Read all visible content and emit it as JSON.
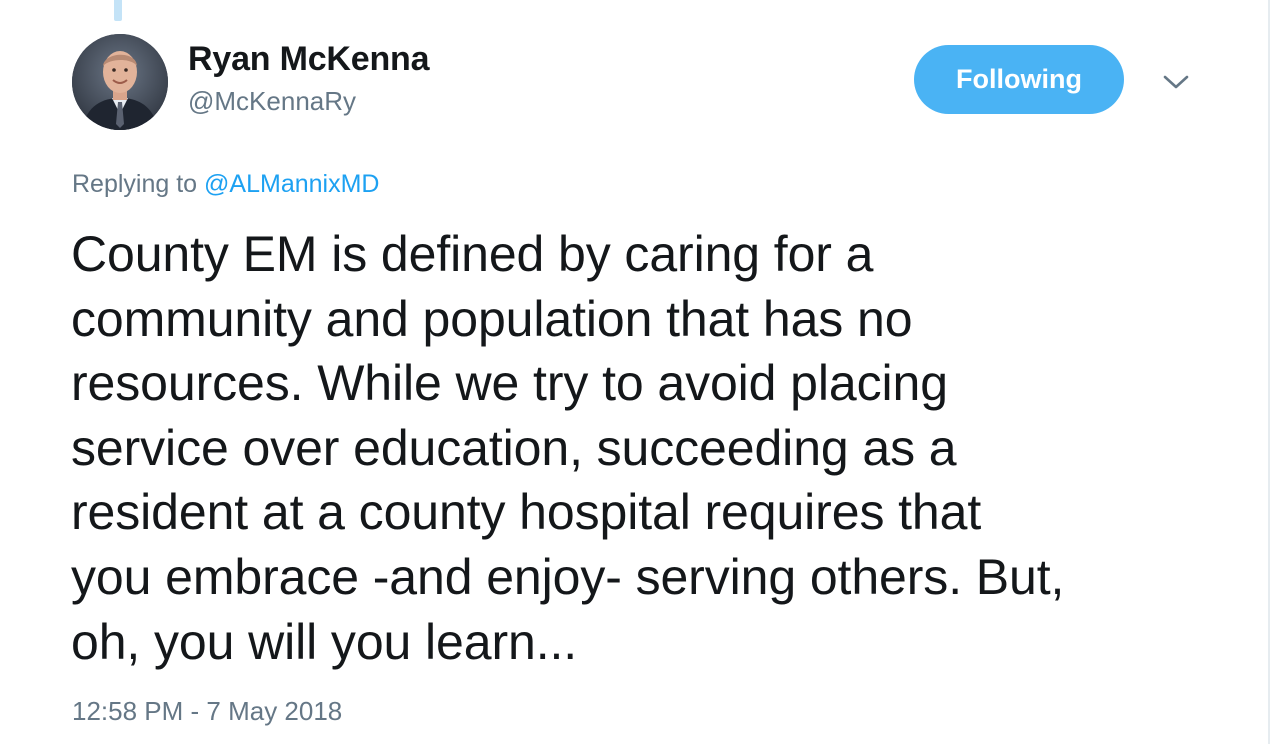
{
  "author": {
    "display_name": "Ryan McKenna",
    "screen_name": "@McKennaRy",
    "avatar_icon": "profile-photo"
  },
  "follow_button": {
    "label": "Following",
    "color": "#4ab3f4"
  },
  "menu": {
    "icon": "chevron-down-icon"
  },
  "reply": {
    "prefix": "Replying to",
    "mention": "@ALMannixMD",
    "mention_color": "#1da1f2"
  },
  "tweet": {
    "lines": [
      "County EM is defined by caring for a",
      "community and population that has no",
      "resources. While we try to avoid placing",
      "service over education, succeeding as a",
      "resident at a county hospital requires that",
      "you embrace -and enjoy- serving others. But,",
      "oh, you will you learn..."
    ],
    "timestamp": "12:58 PM - 7 May 2018"
  },
  "colors": {
    "text": "#14171a",
    "secondary": "#657786",
    "thread_line": "#c4e3f7"
  }
}
